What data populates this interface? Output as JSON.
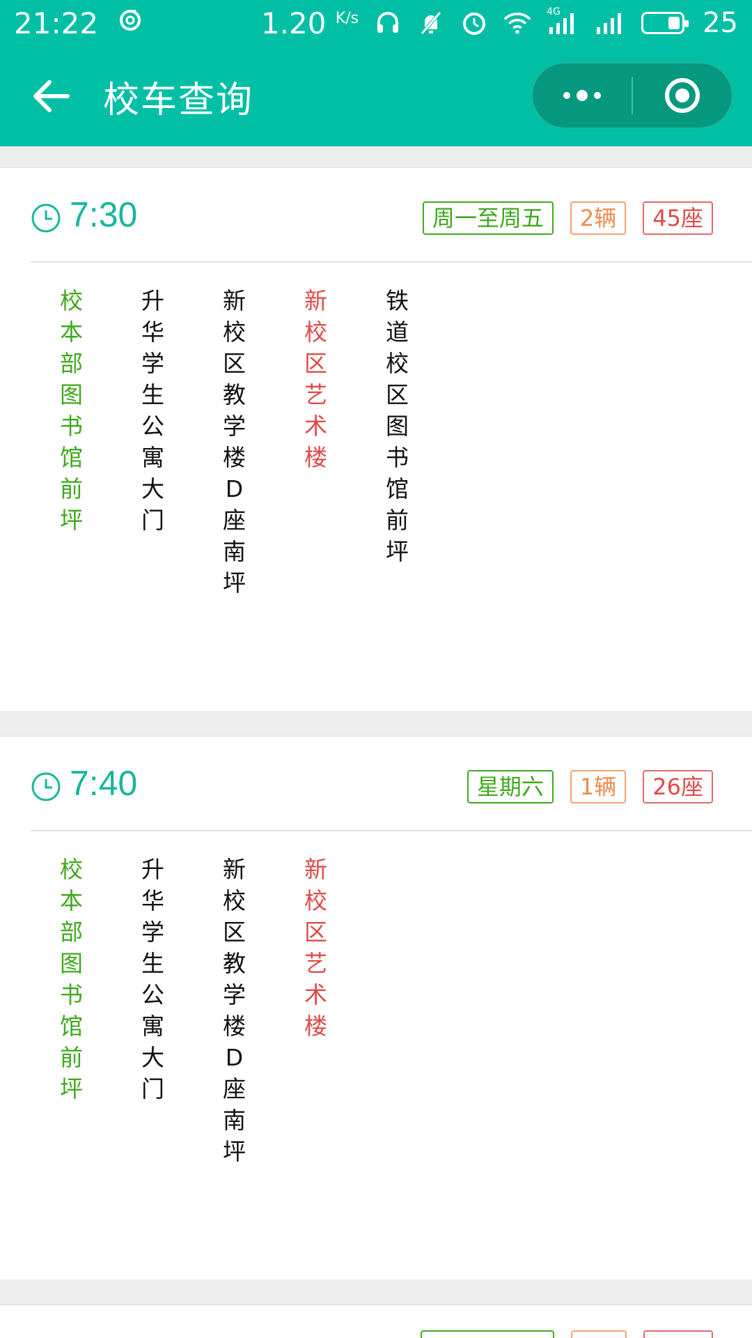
{
  "status_bar": {
    "time": "21:22",
    "net_speed": "1.20",
    "net_unit": "K/s",
    "network_type": "4G",
    "battery": "25"
  },
  "nav": {
    "title": "校车查询"
  },
  "trips": [
    {
      "time": "7:30",
      "days": "周一至周五",
      "buses": "2辆",
      "seats": "45座",
      "stops": [
        {
          "name": "校本部图书馆前坪",
          "kind": "start"
        },
        {
          "name": "升华学生公寓大门",
          "kind": "mid"
        },
        {
          "name": "新校区教学楼D座南坪",
          "kind": "mid"
        },
        {
          "name": "新校区艺术楼",
          "kind": "end"
        },
        {
          "name": "铁道校区图书馆前坪",
          "kind": "mid"
        }
      ]
    },
    {
      "time": "7:40",
      "days": "星期六",
      "buses": "1辆",
      "seats": "26座",
      "stops": [
        {
          "name": "校本部图书馆前坪",
          "kind": "start"
        },
        {
          "name": "升华学生公寓大门",
          "kind": "mid"
        },
        {
          "name": "新校区教学楼D座南坪",
          "kind": "mid"
        },
        {
          "name": "新校区艺术楼",
          "kind": "end"
        }
      ]
    }
  ],
  "colors": {
    "header": "#00bfa5",
    "time_text": "#17b79b",
    "start_stop": "#3fa91d",
    "end_stop": "#e04a4a",
    "buses_tag": "#f08a4b"
  }
}
